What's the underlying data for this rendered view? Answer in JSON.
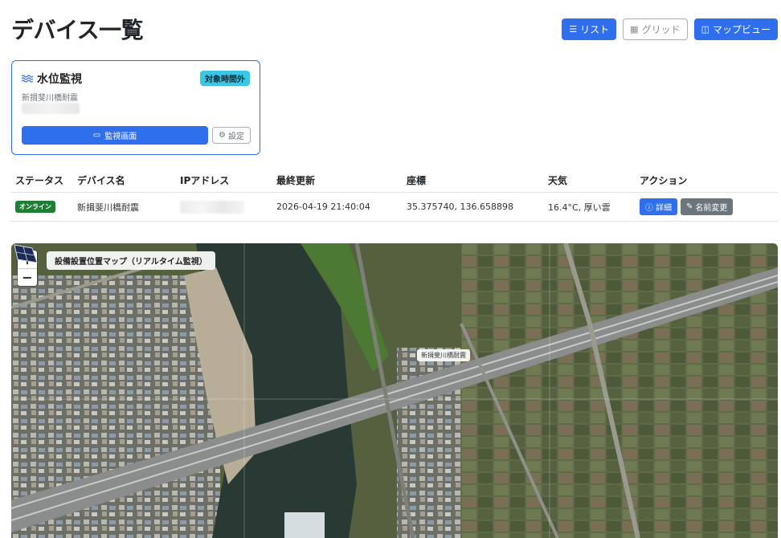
{
  "page": {
    "title": "デバイス一覧"
  },
  "view_switch": {
    "list_label": "リスト",
    "grid_label": "グリッド",
    "map_label": "マップビュー"
  },
  "device_card": {
    "title": "水位監視",
    "badge": "対象時間外",
    "subtitle": "新揖斐川橋耐震",
    "monitor_label": "監視画面",
    "settings_label": "設定"
  },
  "table": {
    "headers": [
      "ステータス",
      "デバイス名",
      "IPアドレス",
      "最終更新",
      "座標",
      "天気",
      "アクション"
    ],
    "rows": [
      {
        "status": "オンライン",
        "name": "新揖斐川橋耐震",
        "last_update": "2026-04-19 21:40:04",
        "coords": "35.375740, 136.658898",
        "weather": "16.4°C, 厚い雲",
        "detail_label": "詳細",
        "rename_label": "名前変更"
      }
    ]
  },
  "map": {
    "title": "設備設置位置マップ（リアルタイム監視）",
    "zoom_in": "+",
    "zoom_out": "−",
    "marker_label": "新揖斐川橋耐震"
  },
  "colors": {
    "primary": "#2f6fed",
    "online": "#1e7e34",
    "badge_cyan": "#3cc6e6",
    "secondary": "#6c757d"
  }
}
